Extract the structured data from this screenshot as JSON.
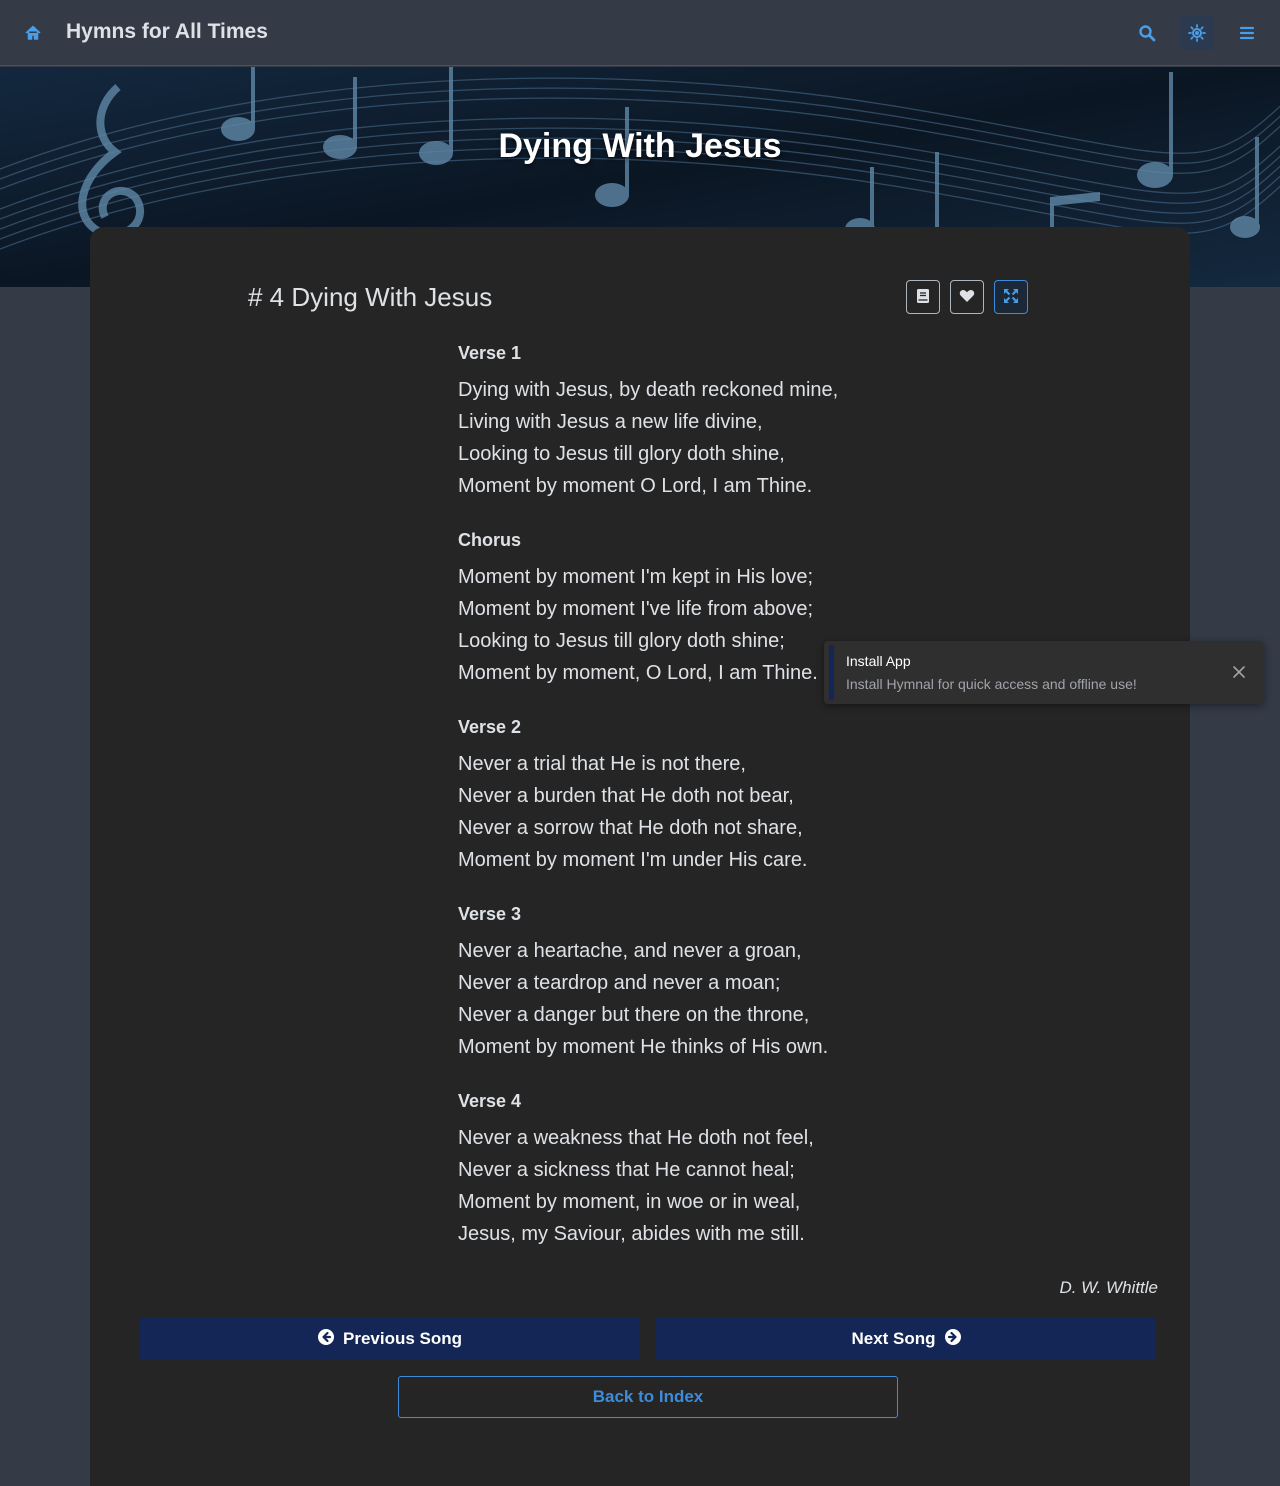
{
  "navbar": {
    "brand": "Hymns for All Times",
    "icons": [
      "home-icon",
      "search-icon",
      "sun-icon",
      "menu-icon"
    ]
  },
  "hero": {
    "title": "Dying With Jesus"
  },
  "song": {
    "number_label": "# 4",
    "title": "Dying With Jesus",
    "author": "D. W. Whittle",
    "sections": [
      {
        "label": "Verse 1",
        "lines": [
          "Dying with Jesus, by death reckoned mine,",
          "Living with Jesus a new life divine,",
          "Looking to Jesus till glory doth shine,",
          "Moment by moment O Lord, I am Thine."
        ]
      },
      {
        "label": "Chorus",
        "lines": [
          "Moment by moment I'm kept in His love;",
          "Moment by moment I've life from above;",
          "Looking to Jesus till glory doth shine;",
          "Moment by moment, O Lord, I am Thine."
        ]
      },
      {
        "label": "Verse 2",
        "lines": [
          "Never a trial that He is not there,",
          "Never a burden that He doth not bear,",
          "Never a sorrow that He doth not share,",
          "Moment by moment I'm under His care."
        ]
      },
      {
        "label": "Verse 3",
        "lines": [
          "Never a heartache, and never a groan,",
          "Never a teardrop and never a moan;",
          "Never a danger but there on the throne,",
          "Moment by moment He thinks of His own."
        ]
      },
      {
        "label": "Verse 4",
        "lines": [
          "Never a weakness that He doth not feel,",
          "Never a sickness that He cannot heal;",
          "Moment by moment, in woe or in weal,",
          "Jesus, my Saviour, abides with me still."
        ]
      }
    ]
  },
  "buttons": {
    "previous": "Previous Song",
    "next": "Next Song",
    "back": "Back to Index"
  },
  "toast": {
    "title": "Install App",
    "message": "Install Hymnal for quick access and offline use!"
  },
  "colors": {
    "accent": "#3d8bd9",
    "nav_button": "#132655",
    "card_bg": "#252525",
    "page_bg": "#343a46"
  }
}
